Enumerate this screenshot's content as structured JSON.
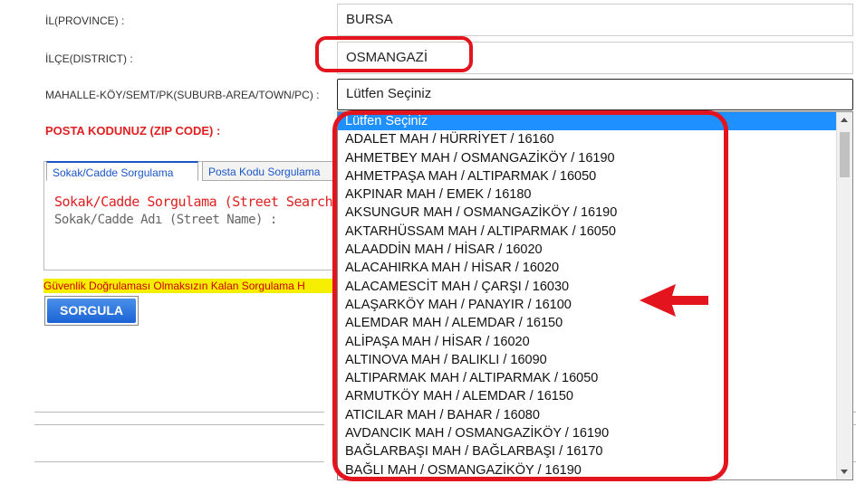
{
  "form": {
    "province_label": "İL(PROVINCE) :",
    "province_value": "BURSA",
    "district_label": "İLÇE(DISTRICT) :",
    "district_value": "OSMANGAZİ",
    "suburb_label": "MAHALLE-KÖY/SEMT/PK(SUBURB-AREA/TOWN/PC) :",
    "suburb_value": "Lütfen Seçiniz",
    "zip_label": "POSTA KODUNUZ (ZIP CODE) :"
  },
  "tabs": [
    {
      "label": "Sokak/Cadde Sorgulama"
    },
    {
      "label": "Posta Kodu Sorgulama"
    }
  ],
  "panel": {
    "title": "Sokak/Cadde Sorgulama (Street Search",
    "street_label": "Sokak/Cadde Adı (Street Name) :"
  },
  "warning": "Güvenlik Doğrulaması Olmaksızın Kalan Sorgulama H",
  "search_button": "SORGULA",
  "dropdown": {
    "items": [
      "Lütfen Seçiniz",
      "ADALET MAH / HÜRRİYET / 16160",
      "AHMETBEY MAH / OSMANGAZİKÖY / 16190",
      "AHMETPAŞA MAH / ALTIPARMAK / 16050",
      "AKPINAR MAH / EMEK / 16180",
      "AKSUNGUR MAH / OSMANGAZİKÖY / 16190",
      "AKTARHÜSSAM MAH / ALTIPARMAK / 16050",
      "ALAADDİN MAH / HİSAR / 16020",
      "ALACAHIRKA MAH / HİSAR / 16020",
      "ALACAMESCİT MAH / ÇARŞI / 16030",
      "ALAŞARKÖY MAH / PANAYIR / 16100",
      "ALEMDAR MAH / ALEMDAR / 16150",
      "ALİPAŞA MAH / HİSAR / 16020",
      "ALTINOVA MAH / BALIKLI / 16090",
      "ALTIPARMAK MAH / ALTIPARMAK / 16050",
      "ARMUTKÖY MAH / ALEMDAR / 16150",
      "ATICILAR MAH / BAHAR / 16080",
      "AVDANCIK MAH / OSMANGAZİKÖY / 16190",
      "BAĞLARBAŞI MAH / BAĞLARBAŞI / 16170",
      "BAĞLI MAH / OSMANGAZİKÖY / 16190"
    ],
    "selected_index": 0
  },
  "colors": {
    "highlight": "#e3141e",
    "selection": "#1e90ff",
    "button": "#1b63d5",
    "warning_bg": "#f6ee00"
  }
}
